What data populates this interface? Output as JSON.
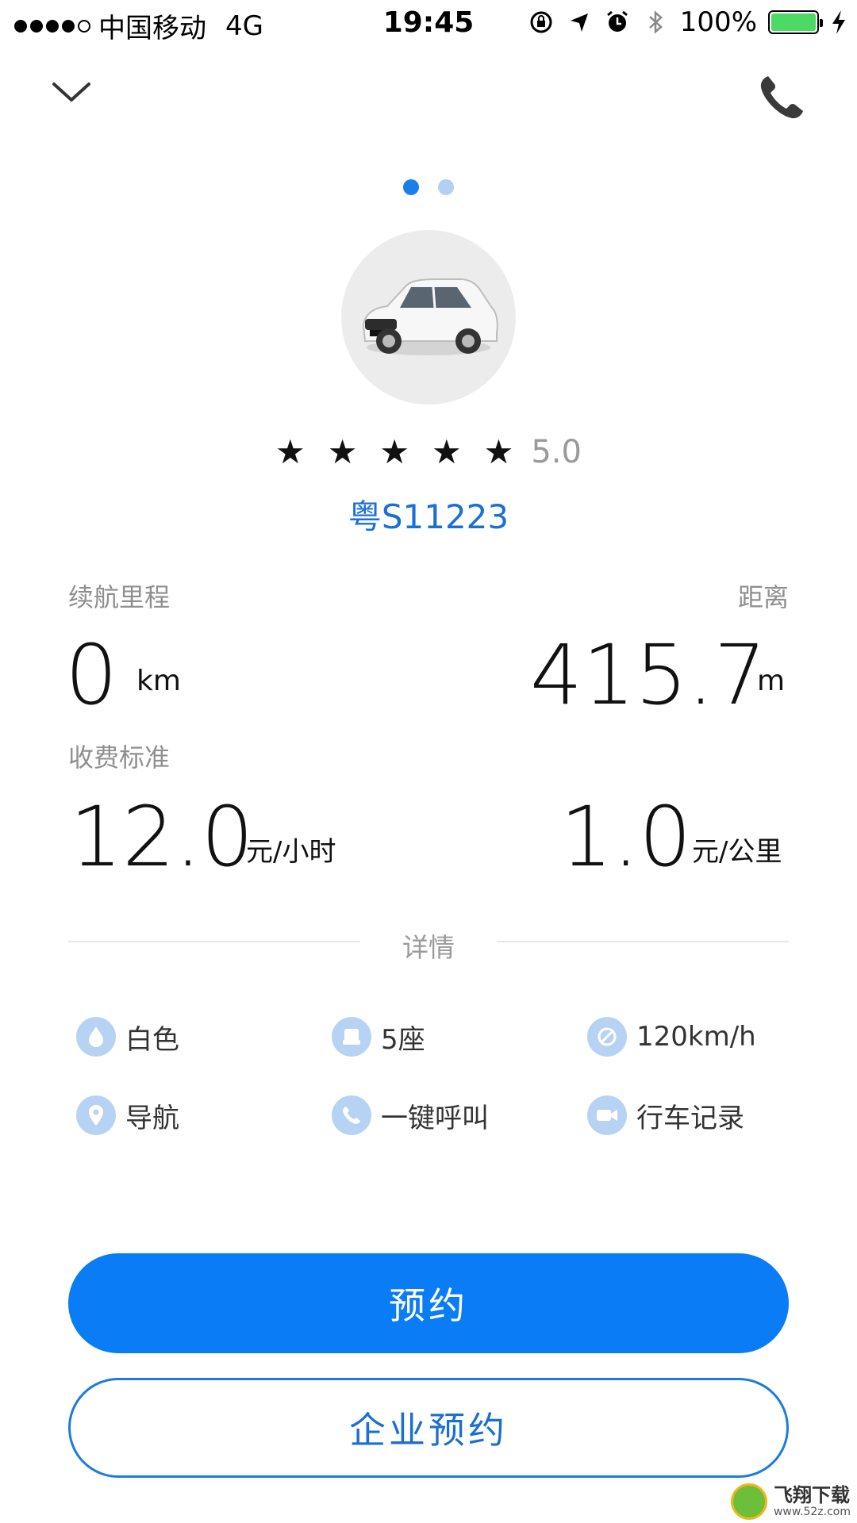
{
  "status_bar": {
    "carrier": "中国移动",
    "network": "4G",
    "time": "19:45",
    "battery": "100%",
    "battery_level": 1.0,
    "battery_color": "#4cd964"
  },
  "header": {
    "back_icon": "chevron-down-icon",
    "call_icon": "phone-icon"
  },
  "pager": {
    "page": 1,
    "total": 2
  },
  "car": {
    "rating_stars": 5,
    "rating": "5.0",
    "plate": "粤S11223"
  },
  "stats": {
    "range_label": "续航里程",
    "range_value": "0",
    "range_unit": "km",
    "distance_label": "距离",
    "distance_value": "415.7",
    "distance_unit": "m",
    "fee_label": "收费标准",
    "hourly_value": "12.0",
    "hourly_unit": "元/小时",
    "mileage_value": "1.0",
    "mileage_unit": "元/公里"
  },
  "details": {
    "title": "详情",
    "features": [
      {
        "label": "白色",
        "icon": "paint-drop-icon"
      },
      {
        "label": "5座",
        "icon": "seat-icon"
      },
      {
        "label": "120km/h",
        "icon": "speed-limit-icon"
      },
      {
        "label": "导航",
        "icon": "location-pin-icon"
      },
      {
        "label": "一键呼叫",
        "icon": "phone-icon"
      },
      {
        "label": "行车记录",
        "icon": "video-camera-icon"
      }
    ]
  },
  "actions": {
    "reserve": "预约",
    "enterprise_reserve": "企业预约"
  },
  "watermark": {
    "name": "飞翔下载",
    "url": "www.52z.com"
  },
  "colors": {
    "accent": "#0a7cf5",
    "plate": "#1a6fd6",
    "icon_bg": "#b7d3f4"
  }
}
